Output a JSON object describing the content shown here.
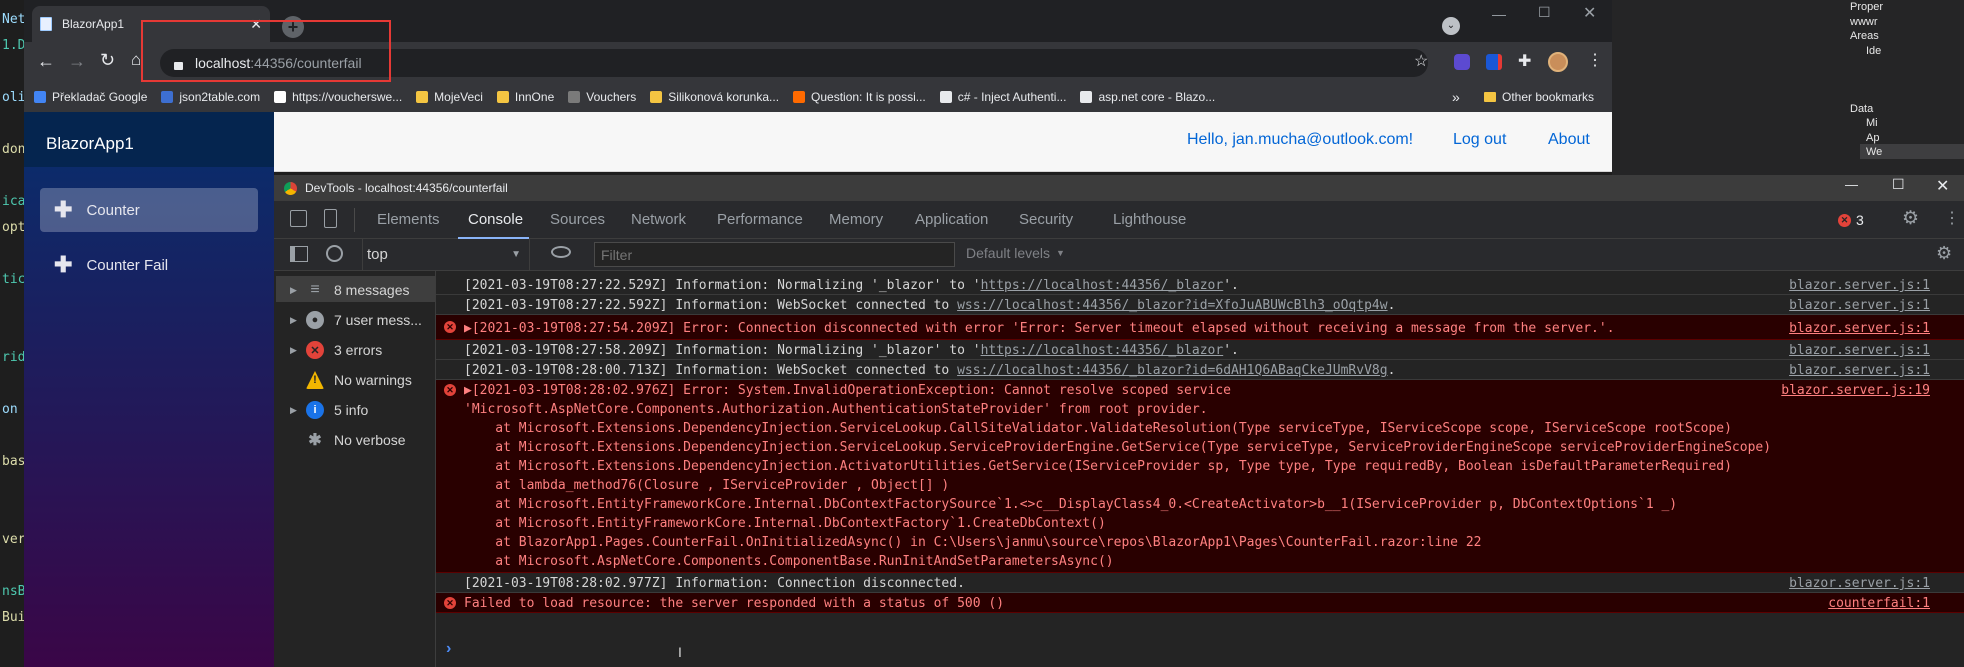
{
  "ide_left": [
    "Net",
    "1.D",
    "",
    "oli",
    "",
    "don",
    "",
    "ica",
    "opt",
    "",
    "tic",
    "",
    "",
    "rid",
    "",
    "on",
    "",
    "bas",
    "",
    "",
    "ver",
    "",
    "nsB",
    "Bui"
  ],
  "ide_right": [
    "Proper",
    "wwwr",
    "Areas",
    "Ide",
    "",
    "",
    "",
    "Data",
    "Mi",
    "Ap",
    "We"
  ],
  "browser": {
    "tab_title": "BlazorApp1",
    "url_host": "localhost",
    "url_path": ":44356/counterfail",
    "bookmarks": [
      "Překladač Google",
      "json2table.com",
      "https://voucherswe...",
      "MojeVeci",
      "InnOne",
      "Vouchers",
      "Silikonová korunka...",
      "Question: It is possi...",
      "c# - Inject Authenti...",
      "asp.net core - Blazo..."
    ],
    "other_bookmarks": "Other bookmarks",
    "more": "»"
  },
  "app": {
    "brand": "BlazorApp1",
    "nav": [
      "Counter",
      "Counter Fail"
    ],
    "hello": "Hello, jan.mucha@outlook.com!",
    "logout": "Log out",
    "about": "About"
  },
  "devtools": {
    "title": "DevTools - localhost:44356/counterfail",
    "tabs": [
      "Elements",
      "Console",
      "Sources",
      "Network",
      "Performance",
      "Memory",
      "Application",
      "Security",
      "Lighthouse"
    ],
    "error_count": "3",
    "context": "top",
    "filter_placeholder": "Filter",
    "levels": "Default levels",
    "sidebar": [
      {
        "label": "8 messages",
        "icon": "list-icon"
      },
      {
        "label": "7 user mess...",
        "icon": "user-icon"
      },
      {
        "label": "3 errors",
        "icon": "error-icon"
      },
      {
        "label": "No warnings",
        "icon": "warning-icon"
      },
      {
        "label": "5 info",
        "icon": "info-icon"
      },
      {
        "label": "No verbose",
        "icon": "bug-icon"
      }
    ],
    "messages": [
      {
        "type": "info",
        "pre": "[2021-03-19T08:27:22.529Z] Information: Normalizing '_blazor' to '",
        "link": "https://localhost:44356/_blazor",
        "post": "'.",
        "src": "blazor.server.js:1"
      },
      {
        "type": "info",
        "pre": "[2021-03-19T08:27:22.592Z] Information: WebSocket connected to ",
        "link": "wss://localhost:44356/_blazor?id=XfoJuABUWcBlh3_oOqtp4w",
        "post": ".",
        "src": "blazor.server.js:1"
      },
      {
        "type": "error",
        "pre": "▶[2021-03-19T08:27:54.209Z] Error: Connection disconnected with error 'Error: Server timeout elapsed without receiving a message from the server.'.",
        "link": "",
        "post": "",
        "src": "blazor.server.js:1"
      },
      {
        "type": "info",
        "pre": "[2021-03-19T08:27:58.209Z] Information: Normalizing '_blazor' to '",
        "link": "https://localhost:44356/_blazor",
        "post": "'.",
        "src": "blazor.server.js:1"
      },
      {
        "type": "info",
        "pre": "[2021-03-19T08:28:00.713Z] Information: WebSocket connected to ",
        "link": "wss://localhost:44356/_blazor?id=6dAH1Q6ABaqCkeJUmRvV8g",
        "post": ".",
        "src": "blazor.server.js:1"
      },
      {
        "type": "error",
        "pre": "▶[2021-03-19T08:28:02.976Z] Error: System.InvalidOperationException: Cannot resolve scoped service\n'Microsoft.AspNetCore.Components.Authorization.AuthenticationStateProvider' from root provider.\n    at Microsoft.Extensions.DependencyInjection.ServiceLookup.CallSiteValidator.ValidateResolution(Type serviceType, IServiceScope scope, IServiceScope rootScope)\n    at Microsoft.Extensions.DependencyInjection.ServiceLookup.ServiceProviderEngine.GetService(Type serviceType, ServiceProviderEngineScope serviceProviderEngineScope)\n    at Microsoft.Extensions.DependencyInjection.ActivatorUtilities.GetService(IServiceProvider sp, Type type, Type requiredBy, Boolean isDefaultParameterRequired)\n    at lambda_method76(Closure , IServiceProvider , Object[] )\n    at Microsoft.EntityFrameworkCore.Internal.DbContextFactorySource`1.<>c__DisplayClass4_0.<CreateActivator>b__1(IServiceProvider p, DbContextOptions`1 _)\n    at Microsoft.EntityFrameworkCore.Internal.DbContextFactory`1.CreateDbContext()\n    at BlazorApp1.Pages.CounterFail.OnInitializedAsync() in C:\\Users\\janmu\\source\\repos\\BlazorApp1\\Pages\\CounterFail.razor:line 22\n    at Microsoft.AspNetCore.Components.ComponentBase.RunInitAndSetParametersAsync()",
        "link": "",
        "post": "",
        "src": "blazor.server.js:19"
      },
      {
        "type": "info",
        "pre": "[2021-03-19T08:28:02.977Z] Information: Connection disconnected.",
        "link": "",
        "post": "",
        "src": "blazor.server.js:1"
      },
      {
        "type": "error",
        "pre": "Failed to load resource: the server responded with a status of 500 ()",
        "link": "",
        "post": "",
        "src": "counterfail:1"
      }
    ],
    "prompt": "›"
  },
  "colors": {
    "accent": "#0366d6",
    "error_bg": "#290000",
    "error_text": "#ff8080",
    "highlight": "#e53935"
  }
}
